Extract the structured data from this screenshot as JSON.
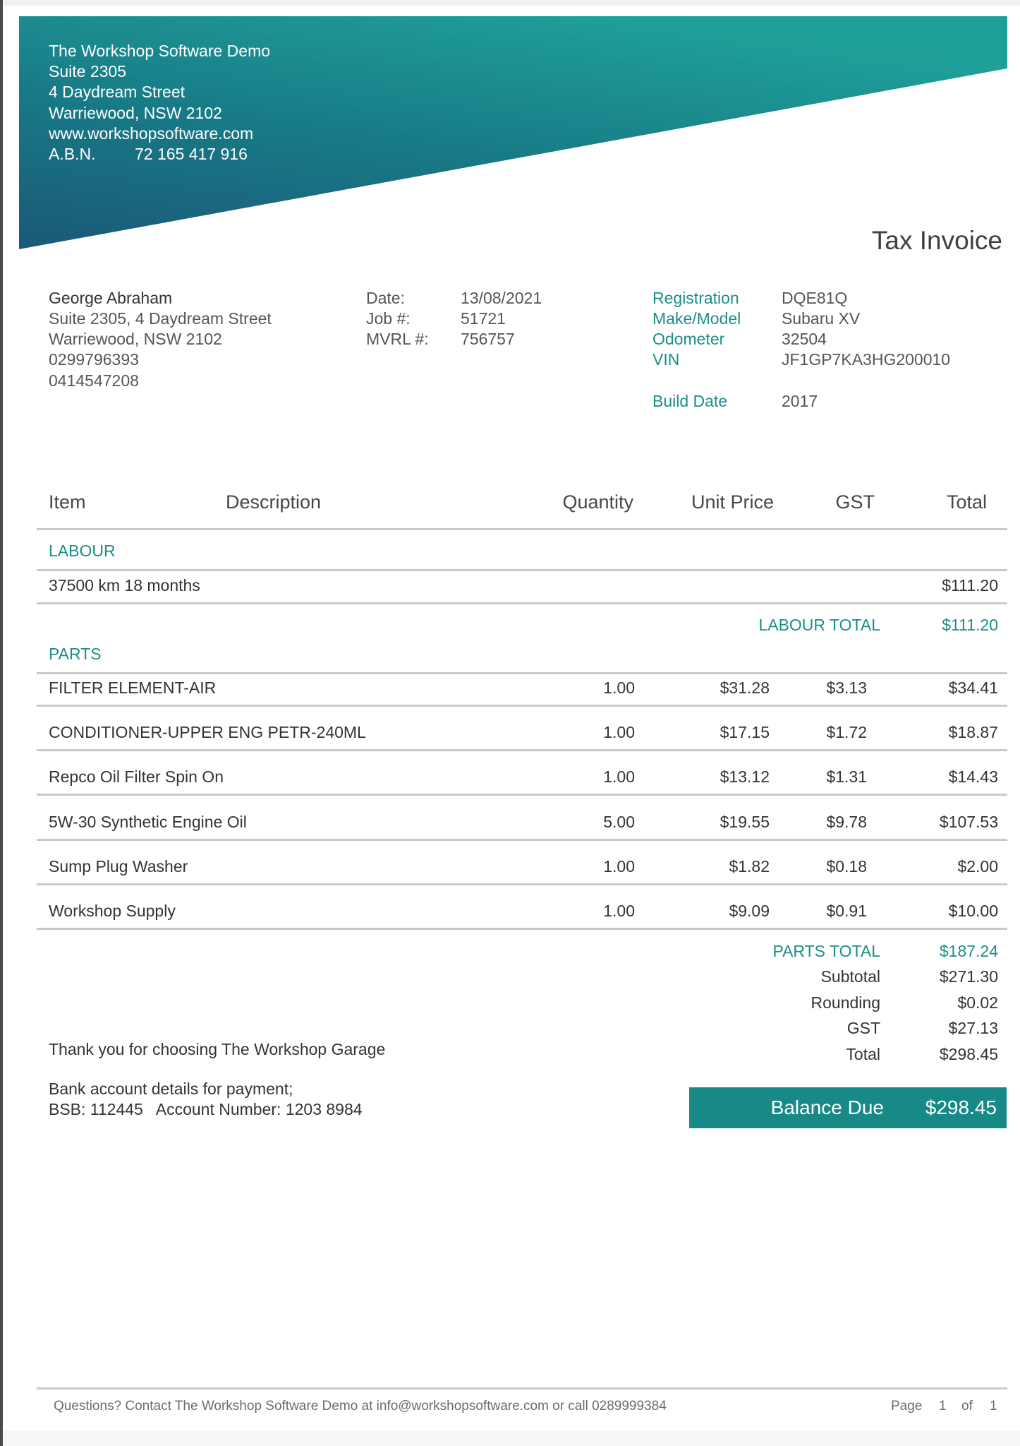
{
  "company": {
    "lines": [
      "The Workshop Software Demo",
      "Suite 2305",
      "4 Daydream Street",
      "Warriewood, NSW 2102",
      "www.workshopsoftware.com"
    ],
    "abn_label": "A.B.N.",
    "abn_value": "72 165 417 916"
  },
  "document_title": "Tax Invoice",
  "customer": {
    "name": "George Abraham",
    "address1": "Suite 2305, 4 Daydream Street",
    "address2": "Warriewood, NSW 2102",
    "phone1": "0299796393",
    "phone2": "0414547208"
  },
  "invoice_meta": [
    {
      "label": "Date:",
      "value": "13/08/2021"
    },
    {
      "label": "Job #:",
      "value": "51721"
    },
    {
      "label": "MVRL #:",
      "value": "756757"
    }
  ],
  "vehicle": [
    {
      "label": "Registration",
      "value": "DQE81Q"
    },
    {
      "label": "Make/Model",
      "value": "Subaru XV"
    },
    {
      "label": "Odometer",
      "value": "32504"
    },
    {
      "label": "VIN",
      "value": "JF1GP7KA3HG200010"
    }
  ],
  "build_date": {
    "label": "Build Date",
    "value": "2017"
  },
  "table": {
    "headers": {
      "item": "Item",
      "description": "Description",
      "quantity": "Quantity",
      "unit_price": "Unit Price",
      "gst": "GST",
      "total": "Total"
    },
    "labour": {
      "section_label": "LABOUR",
      "items": [
        {
          "description": "37500 km 18 months",
          "total": "$111.20"
        }
      ],
      "total_label": "LABOUR TOTAL",
      "total_value": "$111.20"
    },
    "parts": {
      "section_label": "PARTS",
      "items": [
        {
          "description": "FILTER ELEMENT-AIR",
          "quantity": "1.00",
          "unit_price": "$31.28",
          "gst": "$3.13",
          "total": "$34.41"
        },
        {
          "description": "CONDITIONER-UPPER ENG PETR-240ML",
          "quantity": "1.00",
          "unit_price": "$17.15",
          "gst": "$1.72",
          "total": "$18.87"
        },
        {
          "description": "Repco Oil Filter Spin On",
          "quantity": "1.00",
          "unit_price": "$13.12",
          "gst": "$1.31",
          "total": "$14.43"
        },
        {
          "description": "5W-30 Synthetic Engine Oil",
          "quantity": "5.00",
          "unit_price": "$19.55",
          "gst": "$9.78",
          "total": "$107.53"
        },
        {
          "description": "Sump Plug Washer",
          "quantity": "1.00",
          "unit_price": "$1.82",
          "gst": "$0.18",
          "total": "$2.00"
        },
        {
          "description": "Workshop Supply",
          "quantity": "1.00",
          "unit_price": "$9.09",
          "gst": "$0.91",
          "total": "$10.00"
        }
      ],
      "total_label": "PARTS TOTAL",
      "total_value": "$187.24"
    }
  },
  "summary": [
    {
      "label": "Subtotal",
      "value": "$271.30"
    },
    {
      "label": "Rounding",
      "value": "$0.02"
    },
    {
      "label": "GST",
      "value": "$27.13"
    },
    {
      "label": "Total",
      "value": "$298.45"
    }
  ],
  "balance_due": {
    "label": "Balance Due",
    "value": "$298.45"
  },
  "notes": {
    "thank_you": "Thank you for choosing The Workshop Garage",
    "bank_heading": "Bank account details for payment;",
    "bank_details": "BSB: 112445   Account Number: 1203 8984"
  },
  "footer": {
    "contact": "Questions? Contact The Workshop Software Demo at info@workshopsoftware.com or call 0289999384",
    "page_label": "Page",
    "page_current": "1",
    "page_of": "of",
    "page_total": "1"
  },
  "colors": {
    "brand_teal": "#1b8f86",
    "banner_dark": "#1a5c7e",
    "banner_light": "#1fa09b",
    "balance_bg": "#178a88"
  }
}
